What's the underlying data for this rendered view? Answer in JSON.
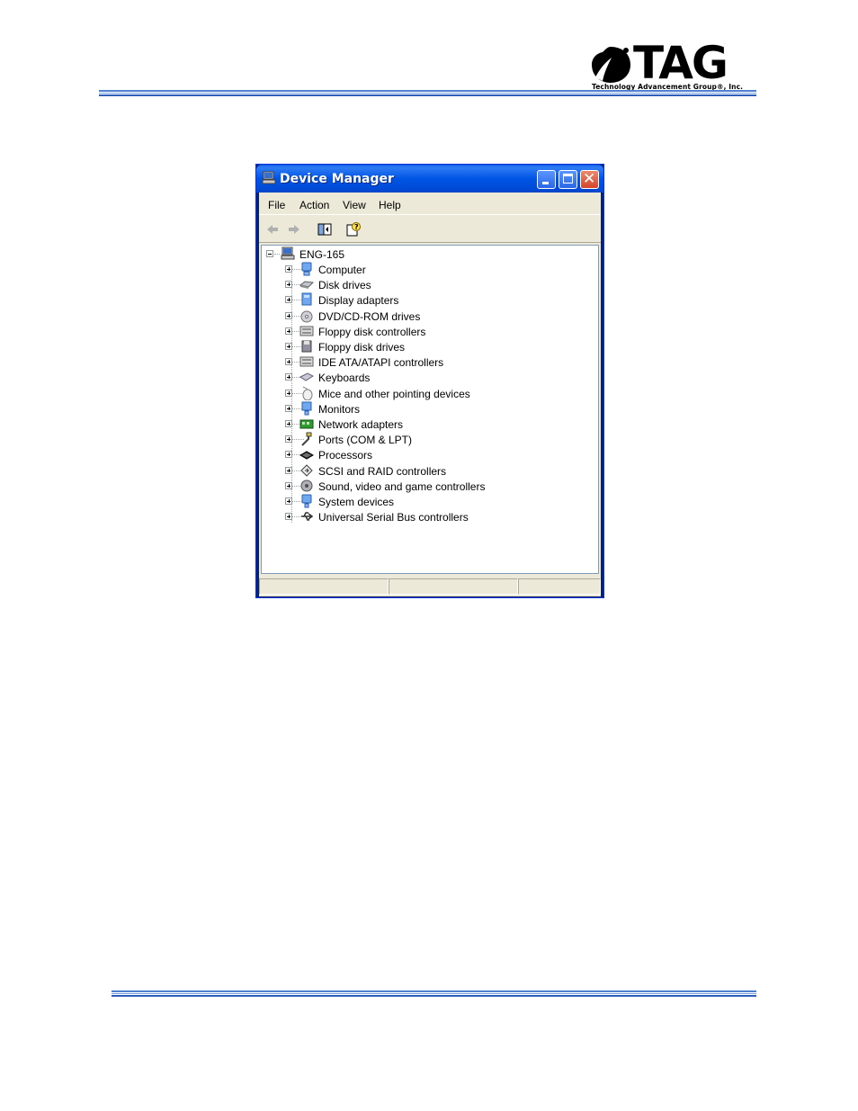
{
  "header": {
    "logo_text": "TAG",
    "logo_subtitle": "Technology Advancement Group®, Inc."
  },
  "window": {
    "title": "Device Manager",
    "menu": [
      "File",
      "Action",
      "View",
      "Help"
    ],
    "toolbar": [
      "back-icon",
      "forward-icon",
      "show-hide-console-tree-icon",
      "help-icon"
    ],
    "root": "ENG-165",
    "devices": [
      {
        "label": "Computer",
        "icon": "computer-icon"
      },
      {
        "label": "Disk drives",
        "icon": "disk-drive-icon"
      },
      {
        "label": "Display adapters",
        "icon": "display-adapter-icon"
      },
      {
        "label": "DVD/CD-ROM drives",
        "icon": "cdrom-icon"
      },
      {
        "label": "Floppy disk controllers",
        "icon": "floppy-controller-icon"
      },
      {
        "label": "Floppy disk drives",
        "icon": "floppy-drive-icon"
      },
      {
        "label": "IDE ATA/ATAPI controllers",
        "icon": "ide-controller-icon"
      },
      {
        "label": "Keyboards",
        "icon": "keyboard-icon"
      },
      {
        "label": "Mice and other pointing devices",
        "icon": "mouse-icon"
      },
      {
        "label": "Monitors",
        "icon": "monitor-icon"
      },
      {
        "label": "Network adapters",
        "icon": "network-adapter-icon"
      },
      {
        "label": "Ports (COM & LPT)",
        "icon": "port-icon"
      },
      {
        "label": "Processors",
        "icon": "processor-icon"
      },
      {
        "label": "SCSI and RAID controllers",
        "icon": "scsi-icon"
      },
      {
        "label": "Sound, video and game controllers",
        "icon": "sound-icon"
      },
      {
        "label": "System devices",
        "icon": "system-device-icon"
      },
      {
        "label": "Universal Serial Bus controllers",
        "icon": "usb-icon"
      }
    ]
  }
}
